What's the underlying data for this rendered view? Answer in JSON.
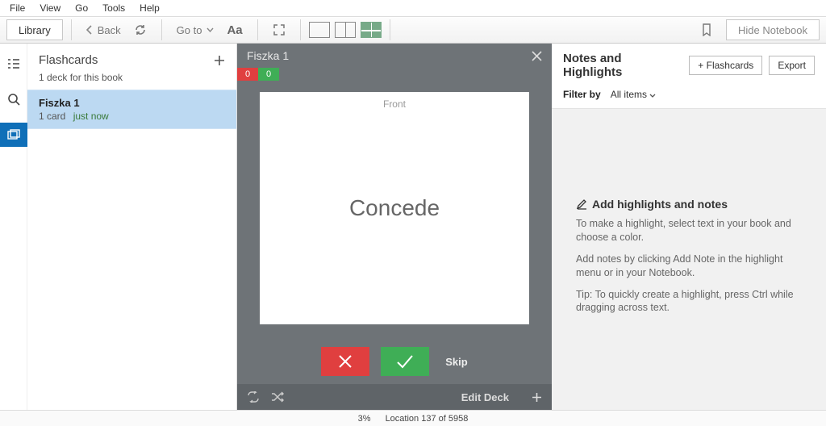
{
  "menu": {
    "file": "File",
    "view": "View",
    "go": "Go",
    "tools": "Tools",
    "help": "Help"
  },
  "toolbar": {
    "library": "Library",
    "back": "Back",
    "goto": "Go to",
    "hide_notebook": "Hide Notebook"
  },
  "flashcards": {
    "title": "Flashcards",
    "subtitle": "1 deck for this book",
    "deck": {
      "name": "Fiszka 1",
      "count": "1 card",
      "time": "just now"
    }
  },
  "viewer": {
    "title": "Fiszka 1",
    "count_wrong": "0",
    "count_right": "0",
    "side_label": "Front",
    "word": "Concede",
    "skip": "Skip",
    "edit_deck": "Edit Deck"
  },
  "notes": {
    "heading": "Notes and Highlights",
    "add_flash": "+ Flashcards",
    "export": "Export",
    "filter_label": "Filter by",
    "filter_value": "All items",
    "cta_title": "Add highlights and notes",
    "p1": "To make a highlight, select text in your book and choose a color.",
    "p2": "Add notes by clicking Add Note in the highlight menu or in your Notebook.",
    "p3": "Tip: To quickly create a highlight, press Ctrl while dragging across text."
  },
  "status": {
    "percent": "3%",
    "location": "Location 137 of 5958"
  }
}
